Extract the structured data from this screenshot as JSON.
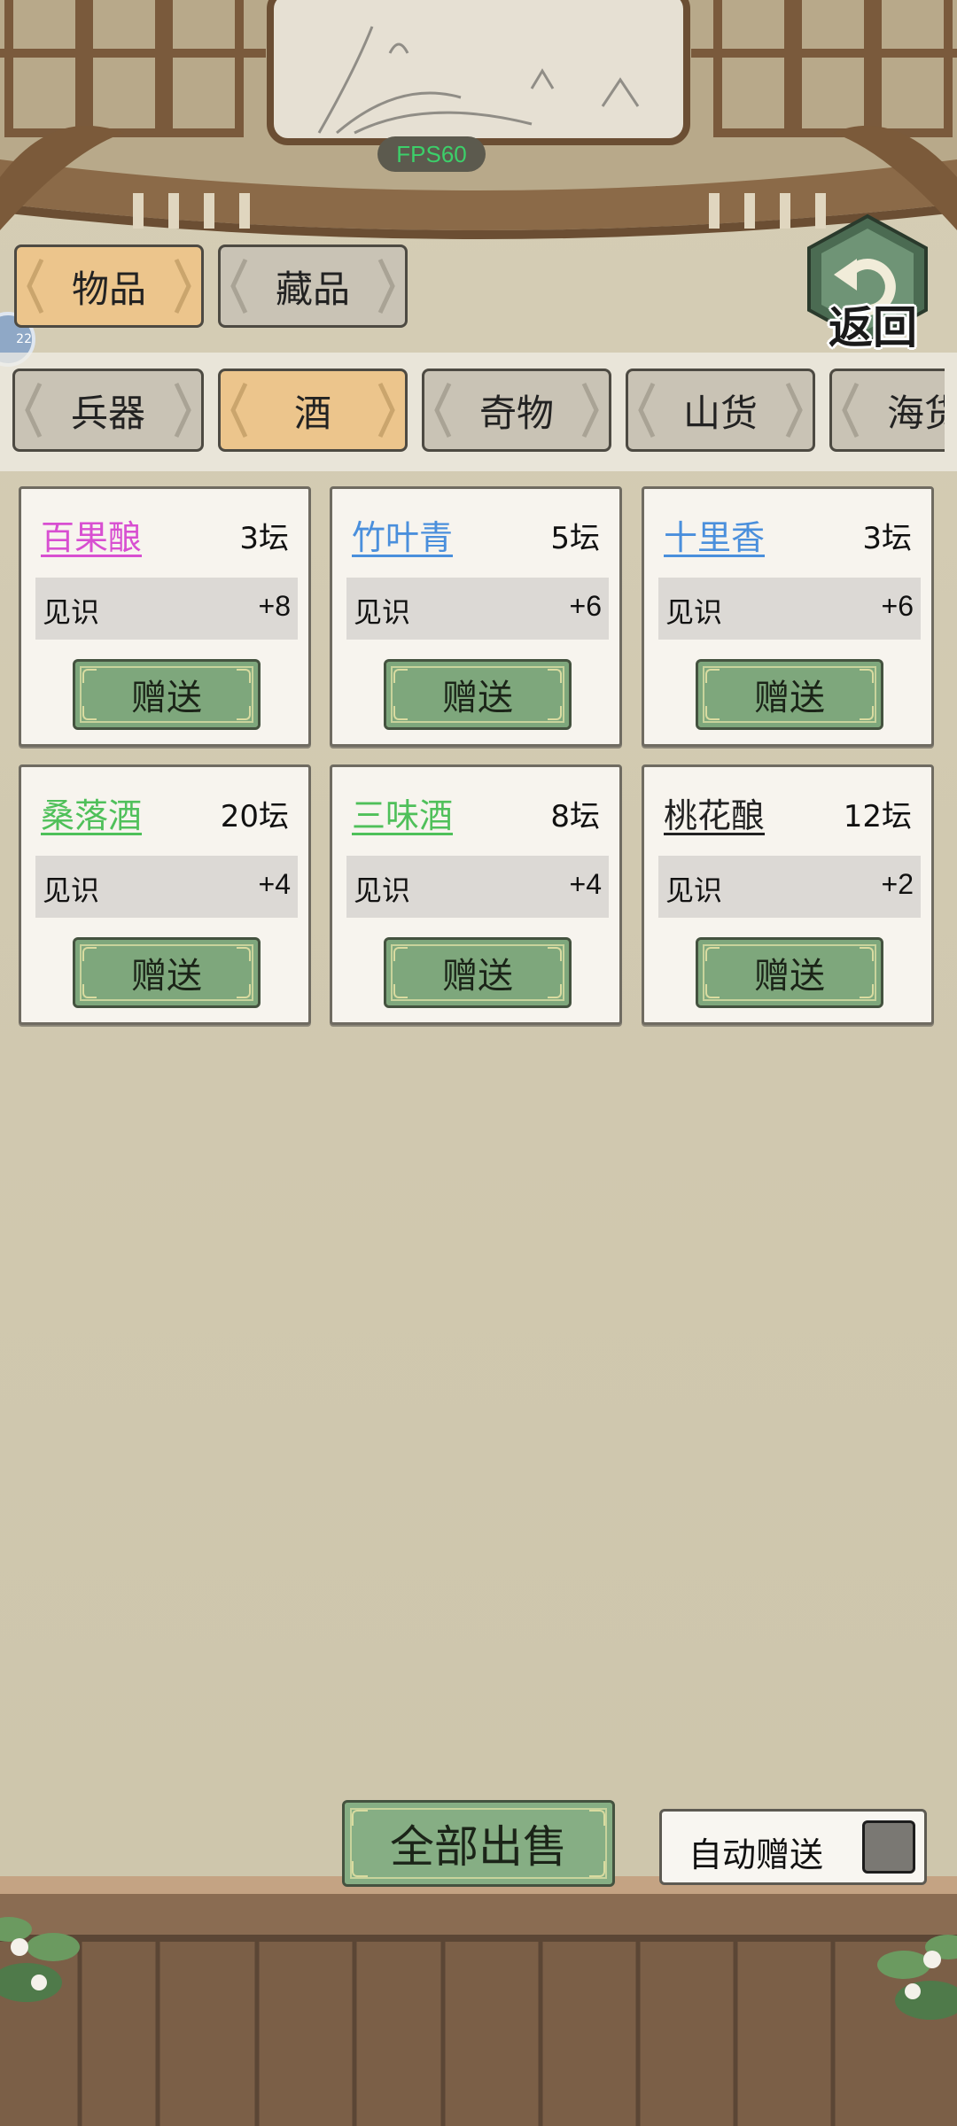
{
  "hud": {
    "fps": "FPS60"
  },
  "back_button": {
    "label": "返回"
  },
  "main_tabs": [
    {
      "label": "物品",
      "active": true
    },
    {
      "label": "藏品",
      "active": false
    }
  ],
  "category_tabs": [
    {
      "label": "兵器",
      "active": false
    },
    {
      "label": "酒",
      "active": true
    },
    {
      "label": "奇物",
      "active": false
    },
    {
      "label": "山货",
      "active": false
    },
    {
      "label": "海货",
      "active": false
    }
  ],
  "items": [
    {
      "name": "百果酿",
      "name_color": "#d84fd1",
      "qty": "3坛",
      "stat_label": "见识",
      "stat_value": "+8",
      "button": "赠送"
    },
    {
      "name": "竹叶青",
      "name_color": "#4a8fdc",
      "qty": "5坛",
      "stat_label": "见识",
      "stat_value": "+6",
      "button": "赠送"
    },
    {
      "name": "十里香",
      "name_color": "#4a8fdc",
      "qty": "3坛",
      "stat_label": "见识",
      "stat_value": "+6",
      "button": "赠送"
    },
    {
      "name": "桑落酒",
      "name_color": "#4fc05a",
      "qty": "20坛",
      "stat_label": "见识",
      "stat_value": "+4",
      "button": "赠送"
    },
    {
      "name": "三味酒",
      "name_color": "#4fc05a",
      "qty": "8坛",
      "stat_label": "见识",
      "stat_value": "+4",
      "button": "赠送"
    },
    {
      "name": "桃花酿",
      "name_color": "#222222",
      "qty": "12坛",
      "stat_label": "见识",
      "stat_value": "+2",
      "button": "赠送"
    }
  ],
  "footer": {
    "sell_all": "全部出售",
    "auto_gift": "自动赠送",
    "auto_gift_enabled": false
  },
  "colors": {
    "tab_active": "#ecc58c",
    "tab_inactive": "#c9c3b5",
    "button_green": "#7ea77c"
  }
}
